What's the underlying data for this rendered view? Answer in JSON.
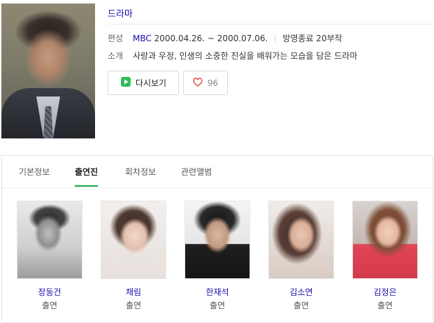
{
  "drama": {
    "title": "드라마",
    "broadcast_label": "편성",
    "channel": "MBC",
    "period": "2000.04.26. ~ 2000.07.06.",
    "status": "방영종료 20부작",
    "synopsis_label": "소개",
    "synopsis": "사랑과 우정, 인생의 소중한 진실을 배워가는 모습을 담은 드라마"
  },
  "actions": {
    "replay_label": "다시보기",
    "like_count": "96"
  },
  "tabs": [
    {
      "label": "기본정보",
      "active": false
    },
    {
      "label": "출연진",
      "active": true
    },
    {
      "label": "회차정보",
      "active": false
    },
    {
      "label": "관련앨범",
      "active": false
    }
  ],
  "cast": [
    {
      "name": "장동건",
      "role": "출연"
    },
    {
      "name": "채림",
      "role": "출연"
    },
    {
      "name": "한재석",
      "role": "출연"
    },
    {
      "name": "김소연",
      "role": "출연"
    },
    {
      "name": "김정은",
      "role": "출연"
    }
  ],
  "colors": {
    "link": "#1a0dab",
    "accent_green": "#1aa34a",
    "heart": "#e8453c"
  },
  "icons": {
    "replay": "play-icon",
    "like": "heart-icon"
  }
}
